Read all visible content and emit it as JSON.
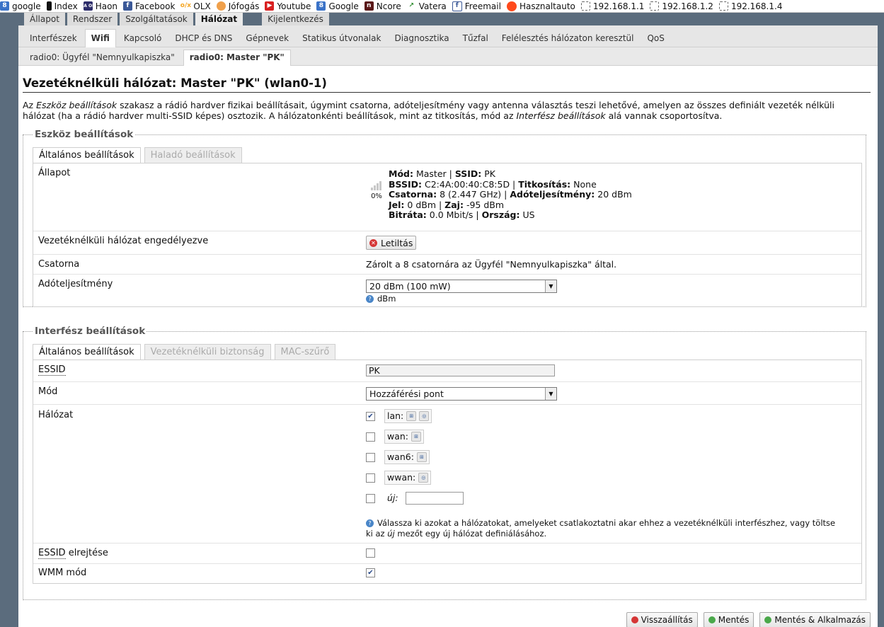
{
  "bookmarks": [
    {
      "label": "google",
      "icon": "google-icon",
      "glyph": "8"
    },
    {
      "label": "Index",
      "icon": "index-icon",
      "glyph": ""
    },
    {
      "label": "Haon",
      "icon": "haon-icon",
      "glyph": "HA ON"
    },
    {
      "label": "Facebook",
      "icon": "facebook-icon",
      "glyph": "f"
    },
    {
      "label": "OLX",
      "icon": "olx-icon",
      "glyph": "o/x"
    },
    {
      "label": "Jófogás",
      "icon": "jofogas-icon",
      "glyph": ""
    },
    {
      "label": "Youtube",
      "icon": "youtube-icon",
      "glyph": "▶"
    },
    {
      "label": "Google",
      "icon": "google-icon",
      "glyph": "8"
    },
    {
      "label": "Ncore",
      "icon": "ncore-icon",
      "glyph": "n"
    },
    {
      "label": "Vatera",
      "icon": "vatera-icon",
      "glyph": "↗"
    },
    {
      "label": "Freemail",
      "icon": "freemail-icon",
      "glyph": "f"
    },
    {
      "label": "Hasznaltauto",
      "icon": "hasznaltauto-icon",
      "glyph": ""
    },
    {
      "label": "192.168.1.1",
      "icon": "page-icon",
      "glyph": ""
    },
    {
      "label": "192.168.1.2",
      "icon": "page-icon",
      "glyph": ""
    },
    {
      "label": "192.168.1.4",
      "icon": "page-icon",
      "glyph": ""
    }
  ],
  "top_tabs": [
    {
      "label": "Állapot",
      "active": false
    },
    {
      "label": "Rendszer",
      "active": false
    },
    {
      "label": "Szolgáltatások",
      "active": false
    },
    {
      "label": "Hálózat",
      "active": true
    }
  ],
  "logout_label": "Kijelentkezés",
  "sub_tabs": [
    {
      "label": "Interfészek",
      "active": false
    },
    {
      "label": "Wifi",
      "active": true
    },
    {
      "label": "Kapcsoló",
      "active": false
    },
    {
      "label": "DHCP és DNS",
      "active": false
    },
    {
      "label": "Gépnevek",
      "active": false
    },
    {
      "label": "Statikus útvonalak",
      "active": false
    },
    {
      "label": "Diagnosztika",
      "active": false
    },
    {
      "label": "Tűzfal",
      "active": false
    },
    {
      "label": "Felélesztés hálózaton keresztül",
      "active": false
    },
    {
      "label": "QoS",
      "active": false
    }
  ],
  "radio_tabs": [
    {
      "label": "radio0: Ügyfél \"Nemnyulkapiszka\"",
      "active": false
    },
    {
      "label": "radio0: Master \"PK\"",
      "active": true
    }
  ],
  "page_title": "Vezetéknélküli hálózat: Master \"PK\" (wlan0-1)",
  "description": {
    "p1": "Az ",
    "i1": "Eszköz beállítások",
    "p2": " szakasz a rádió hardver fizikai beállításait, úgymint csatorna, adóteljesítmény vagy antenna választás teszi lehetővé, amelyen az összes definiált vezeték nélküli hálózat (ha a rádió hardver multi-SSID képes) osztozik. A hálózatonkénti beállítások, mint az titkosítás, mód az ",
    "i2": "Interfész beállítások",
    "p3": " alá vannak csoportosítva."
  },
  "device": {
    "legend": "Eszköz beállítások",
    "tabs": [
      {
        "label": "Általános beállítások",
        "active": true
      },
      {
        "label": "Haladó beállítások",
        "active": false
      }
    ],
    "status_label": "Állapot",
    "signal_percent": "0%",
    "status": {
      "mode_k": "Mód:",
      "mode_v": " Master | ",
      "ssid_k": "SSID:",
      "ssid_v": " PK",
      "bssid_k": "BSSID:",
      "bssid_v": " C2:4A:00:40:C8:5D | ",
      "enc_k": "Titkosítás:",
      "enc_v": " None",
      "chan_k": "Csatorna:",
      "chan_v": " 8 (2.447 GHz) | ",
      "tx_k": "Adóteljesítmény:",
      "tx_v": " 20 dBm",
      "sig_k": "Jel:",
      "sig_v": " 0 dBm | ",
      "noise_k": "Zaj:",
      "noise_v": " -95 dBm",
      "rate_k": "Bitráta:",
      "rate_v": " 0.0 Mbit/s | ",
      "country_k": "Ország:",
      "country_v": " US"
    },
    "enabled_label": "Vezetéknélküli hálózat engedélyezve",
    "disable_button": "Letiltás",
    "channel_label": "Csatorna",
    "channel_value": "Zárolt a 8 csatornára az Ügyfél \"Nemnyulkapiszka\" által.",
    "txpower_label": "Adóteljesítmény",
    "txpower_value": "20 dBm (100 mW)",
    "txpower_help": "dBm"
  },
  "iface": {
    "legend": "Interfész beállítások",
    "tabs": [
      {
        "label": "Általános beállítások",
        "active": true
      },
      {
        "label": "Vezetéknélküli biztonság",
        "active": false
      },
      {
        "label": "MAC-szűrő",
        "active": false
      }
    ],
    "essid_label": "ESSID",
    "essid_value": "PK",
    "mode_label": "Mód",
    "mode_value": "Hozzáférési pont",
    "network_label": "Hálózat",
    "networks": [
      {
        "name": "lan:",
        "checked": true
      },
      {
        "name": "wan:",
        "checked": false
      },
      {
        "name": "wan6:",
        "checked": false
      },
      {
        "name": "wwan:",
        "checked": false
      }
    ],
    "new_label": "új:",
    "network_help_1": "Válassza ki azokat a hálózatokat, amelyeket csatlakoztatni akar ehhez a vezetéknélküli interfészhez, vagy töltse",
    "network_help_2a": "ki az ",
    "network_help_2i": "új",
    "network_help_2b": " mezőt egy új hálózat definiálásához.",
    "hide_essid_abbr": "ESSID",
    "hide_essid_rest": " elrejtése",
    "hide_essid_checked": false,
    "wmm_label": "WMM mód",
    "wmm_checked": true
  },
  "footer_buttons": [
    "Visszaállítás",
    "Mentés",
    "Mentés & Alkalmazás"
  ],
  "colors": {
    "background": "#5b6c7d",
    "panel": "#ffffff",
    "accent": "#4a86c8",
    "danger": "#d53636"
  }
}
